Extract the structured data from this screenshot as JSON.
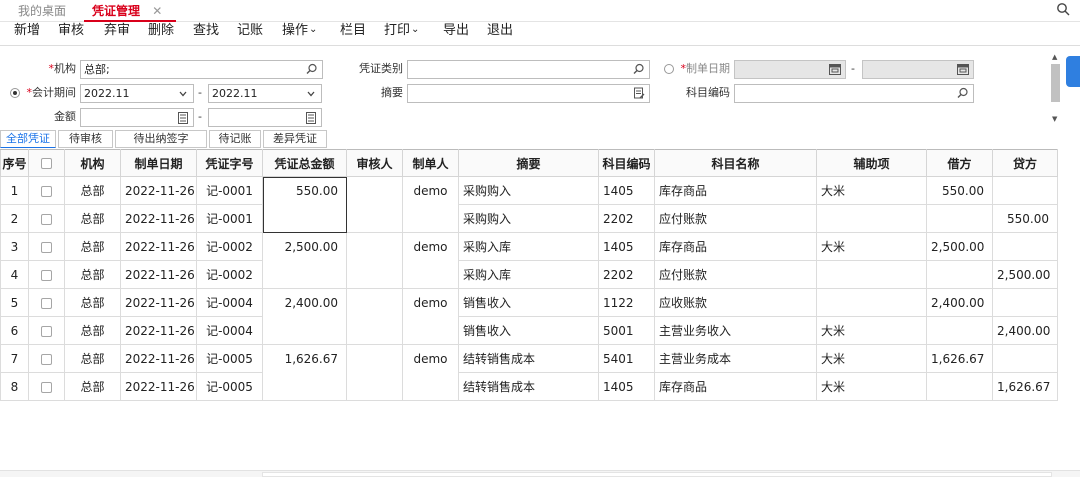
{
  "tabs": {
    "home": "我的桌面",
    "active": "凭证管理",
    "close": "✕"
  },
  "toolbar": {
    "items": [
      {
        "label": "新增"
      },
      {
        "label": "审核"
      },
      {
        "label": "弃审"
      },
      {
        "label": "删除"
      },
      {
        "label": "查找"
      },
      {
        "label": "记账"
      },
      {
        "label": "操作",
        "caret": "⌄"
      },
      {
        "label": "栏目"
      },
      {
        "label": "打印",
        "caret": "⌄"
      },
      {
        "label": "导出"
      },
      {
        "label": "退出"
      }
    ]
  },
  "form": {
    "org_label": "机构",
    "org_value": "总部;",
    "period_label": "会计期间",
    "period_from": "2022.11",
    "period_to": "2022.11",
    "amount_label": "金额",
    "amount_from": "",
    "amount_to": "",
    "voucher_type_label": "凭证类别",
    "voucher_type_value": "",
    "summary_label": "摘要",
    "summary_value": "",
    "date_label": "制单日期",
    "date_from": "",
    "date_to": "",
    "account_code_label": "科目编码",
    "account_code_value": "",
    "required_mark": "*",
    "range_dash": "-"
  },
  "filter_tabs": [
    {
      "label": "全部凭证",
      "active": true
    },
    {
      "label": "待审核",
      "active": false
    },
    {
      "label": "待出纳签字",
      "active": false
    },
    {
      "label": "待记账",
      "active": false
    },
    {
      "label": "差异凭证",
      "active": false
    }
  ],
  "grid": {
    "columns": [
      "序号",
      "",
      "机构",
      "制单日期",
      "凭证字号",
      "凭证总金额",
      "审核人",
      "制单人",
      "摘要",
      "科目编码",
      "科目名称",
      "辅助项",
      "借方",
      "贷方"
    ],
    "vouchers": [
      {
        "total": "550.00",
        "maker": "demo",
        "auditor": "",
        "lines": [
          {
            "no": "1",
            "org": "总部",
            "date": "2022-11-26",
            "voucher_no": "记-0001",
            "summary": "采购购入",
            "code": "1405",
            "account": "库存商品",
            "aux": "大米",
            "debit": "550.00",
            "credit": ""
          },
          {
            "no": "2",
            "org": "总部",
            "date": "2022-11-26",
            "voucher_no": "记-0001",
            "summary": "采购购入",
            "code": "2202",
            "account": "应付账款",
            "aux": "",
            "debit": "",
            "credit": "550.00"
          }
        ]
      },
      {
        "total": "2,500.00",
        "maker": "demo",
        "auditor": "",
        "lines": [
          {
            "no": "3",
            "org": "总部",
            "date": "2022-11-26",
            "voucher_no": "记-0002",
            "summary": "采购入库",
            "code": "1405",
            "account": "库存商品",
            "aux": "大米",
            "debit": "2,500.00",
            "credit": ""
          },
          {
            "no": "4",
            "org": "总部",
            "date": "2022-11-26",
            "voucher_no": "记-0002",
            "summary": "采购入库",
            "code": "2202",
            "account": "应付账款",
            "aux": "",
            "debit": "",
            "credit": "2,500.00"
          }
        ]
      },
      {
        "total": "2,400.00",
        "maker": "demo",
        "auditor": "",
        "lines": [
          {
            "no": "5",
            "org": "总部",
            "date": "2022-11-26",
            "voucher_no": "记-0004",
            "summary": "销售收入",
            "code": "1122",
            "account": "应收账款",
            "aux": "",
            "debit": "2,400.00",
            "credit": ""
          },
          {
            "no": "6",
            "org": "总部",
            "date": "2022-11-26",
            "voucher_no": "记-0004",
            "summary": "销售收入",
            "code": "5001",
            "account": "主营业务收入",
            "aux": "大米",
            "debit": "",
            "credit": "2,400.00"
          }
        ]
      },
      {
        "total": "1,626.67",
        "maker": "demo",
        "auditor": "",
        "lines": [
          {
            "no": "7",
            "org": "总部",
            "date": "2022-11-26",
            "voucher_no": "记-0005",
            "summary": "结转销售成本",
            "code": "5401",
            "account": "主营业务成本",
            "aux": "大米",
            "debit": "1,626.67",
            "credit": ""
          },
          {
            "no": "8",
            "org": "总部",
            "date": "2022-11-26",
            "voucher_no": "记-0005",
            "summary": "结转销售成本",
            "code": "1405",
            "account": "库存商品",
            "aux": "大米",
            "debit": "",
            "credit": "1,626.67"
          }
        ]
      }
    ]
  },
  "colors": {
    "accent_red": "#d9001b",
    "accent_blue": "#1a73e8",
    "side_button": "#2f7fe0"
  }
}
